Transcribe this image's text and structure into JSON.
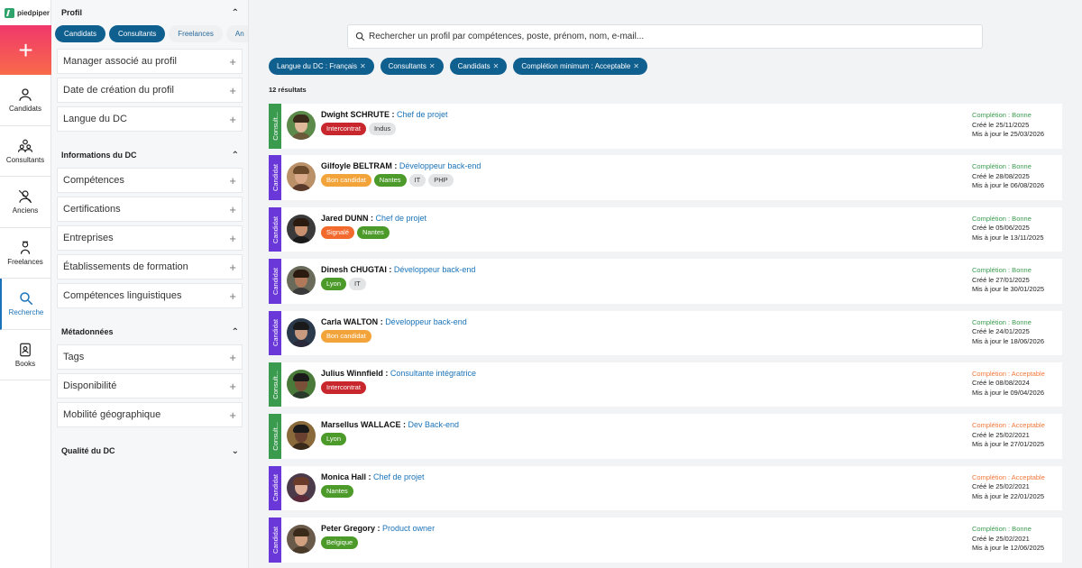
{
  "brand": {
    "name": "piedpiper"
  },
  "nav": {
    "add_symbol": "+",
    "items": [
      {
        "label": "Candidats",
        "icon": "person-icon"
      },
      {
        "label": "Consultants",
        "icon": "team-icon"
      },
      {
        "label": "Anciens",
        "icon": "person-off-icon"
      },
      {
        "label": "Freelances",
        "icon": "freelance-icon"
      },
      {
        "label": "Recherche",
        "icon": "search-icon"
      },
      {
        "label": "Books",
        "icon": "book-icon"
      }
    ]
  },
  "filters": {
    "profil": {
      "title": "Profil",
      "chips": [
        "Candidats",
        "Consultants",
        "Freelances",
        "An"
      ],
      "rows": [
        "Manager associé au profil",
        "Date de création du profil",
        "Langue du DC"
      ]
    },
    "info_dc": {
      "title": "Informations du DC",
      "rows": [
        "Compétences",
        "Certifications",
        "Entreprises",
        "Établissements de formation",
        "Compétences linguistiques"
      ]
    },
    "meta": {
      "title": "Métadonnées",
      "rows": [
        "Tags",
        "Disponibilité",
        "Mobilité géographique"
      ]
    },
    "quality": {
      "title": "Qualité du DC"
    }
  },
  "search": {
    "placeholder": "Rechercher un profil par compétences, poste, prénom, nom, e-mail..."
  },
  "active_tags": [
    "Langue du DC : Français",
    "Consultants",
    "Candidats",
    "Complétion minimum : Acceptable"
  ],
  "results_count": "12 résultats",
  "results": [
    {
      "type": "Consultant",
      "strip": "Consult...",
      "name": "Dwight SCHRUTE",
      "job": "Chef de projet",
      "badges": [
        {
          "t": "Intercontrat",
          "c": "red"
        },
        {
          "t": "Indus",
          "c": "grey"
        }
      ],
      "completion": "Complétion : Bonne",
      "completion_level": "good",
      "created": "Créé le 25/11/2025",
      "updated": "Mis à jour le 25/03/2026",
      "avatar": {
        "bg": "#5b8a4a",
        "hair": "#3a2a1a",
        "skin": "#e0b89a",
        "shirt": "#6b5a3a"
      }
    },
    {
      "type": "Candidat",
      "strip": "Candidat",
      "name": "Gilfoyle BELTRAM",
      "job": "Développeur back-end",
      "badges": [
        {
          "t": "Bon candidat",
          "c": "orange"
        },
        {
          "t": "Nantes",
          "c": "green"
        },
        {
          "t": "IT",
          "c": "grey"
        },
        {
          "t": "PHP",
          "c": "grey"
        }
      ],
      "completion": "Complétion : Bonne",
      "completion_level": "good",
      "created": "Créé le 28/08/2025",
      "updated": "Mis à jour le 06/08/2026",
      "avatar": {
        "bg": "#b99068",
        "hair": "#6a4a2a",
        "skin": "#d9a98a",
        "shirt": "#5a3a2a"
      }
    },
    {
      "type": "Candidat",
      "strip": "Candidat",
      "name": "Jared DUNN",
      "job": "Chef de projet",
      "badges": [
        {
          "t": "Signalé",
          "c": "coral"
        },
        {
          "t": "Nantes",
          "c": "green"
        }
      ],
      "completion": "Complétion : Bonne",
      "completion_level": "good",
      "created": "Créé le 05/06/2025",
      "updated": "Mis à jour le 13/11/2025",
      "avatar": {
        "bg": "#3a3a3a",
        "hair": "#2a1a10",
        "skin": "#c99070",
        "shirt": "#1a1a1a"
      }
    },
    {
      "type": "Candidat",
      "strip": "Candidat",
      "name": "Dinesh CHUGTAI",
      "job": "Développeur back-end",
      "badges": [
        {
          "t": "Lyon",
          "c": "green"
        },
        {
          "t": "IT",
          "c": "grey"
        }
      ],
      "completion": "Complétion : Bonne",
      "completion_level": "good",
      "created": "Créé le 27/01/2025",
      "updated": "Mis à jour le 30/01/2025",
      "avatar": {
        "bg": "#6a6a5a",
        "hair": "#2a1a10",
        "skin": "#b07a5a",
        "shirt": "#3a3a3a"
      }
    },
    {
      "type": "Candidat",
      "strip": "Candidat",
      "name": "Carla WALTON",
      "job": "Développeur back-end",
      "badges": [
        {
          "t": "Bon candidat",
          "c": "orange"
        }
      ],
      "completion": "Complétion : Bonne",
      "completion_level": "good",
      "created": "Créé le 24/01/2025",
      "updated": "Mis à jour le 18/06/2026",
      "avatar": {
        "bg": "#2a3a4a",
        "hair": "#1a1a1a",
        "skin": "#c89a80",
        "shirt": "#2a2a3a"
      }
    },
    {
      "type": "Consultant",
      "strip": "Consult...",
      "name": "Julius Winnfield",
      "job": "Consultante intégratrice",
      "badges": [
        {
          "t": "Intercontrat",
          "c": "red"
        }
      ],
      "completion": "Complétion : Acceptable",
      "completion_level": "ok",
      "created": "Créé le 08/08/2024",
      "updated": "Mis à jour le 09/04/2026",
      "avatar": {
        "bg": "#4a7a3a",
        "hair": "#1a1a1a",
        "skin": "#7a5038",
        "shirt": "#2a3a2a"
      }
    },
    {
      "type": "Consultant",
      "strip": "Consult...",
      "name": "Marsellus WALLACE",
      "job": "Dev Back-end",
      "badges": [
        {
          "t": "Lyon",
          "c": "green"
        }
      ],
      "completion": "Complétion : Acceptable",
      "completion_level": "ok",
      "created": "Créé le 25/02/2021",
      "updated": "Mis à jour le 27/01/2025",
      "avatar": {
        "bg": "#8a6a3a",
        "hair": "#1a1a1a",
        "skin": "#6a4030",
        "shirt": "#3a2a1a"
      }
    },
    {
      "type": "Candidat",
      "strip": "Candidat",
      "name": "Monica Hall",
      "job": "Chef de projet",
      "badges": [
        {
          "t": "Nantes",
          "c": "green"
        }
      ],
      "completion": "Complétion : Acceptable",
      "completion_level": "ok",
      "created": "Créé le 25/02/2021",
      "updated": "Mis à jour le 22/01/2025",
      "avatar": {
        "bg": "#4a3a4a",
        "hair": "#6a3a2a",
        "skin": "#e0b09a",
        "shirt": "#5a2a3a"
      }
    },
    {
      "type": "Candidat",
      "strip": "Candidat",
      "name": "Peter Gregory",
      "job": "Product owner",
      "badges": [
        {
          "t": "Belgique",
          "c": "green"
        }
      ],
      "completion": "Complétion : Bonne",
      "completion_level": "good",
      "created": "Créé le 25/02/2021",
      "updated": "Mis à jour le 12/06/2025",
      "avatar": {
        "bg": "#6a5a4a",
        "hair": "#3a2a1a",
        "skin": "#d0a080",
        "shirt": "#4a3a2a"
      }
    }
  ],
  "colors": {
    "accent": "#0f5f8f",
    "consultant_strip": "#3a9b4f",
    "candidat_strip": "#6a38d8",
    "completion_good": "#3a9b4f",
    "completion_ok": "#f2783a"
  }
}
